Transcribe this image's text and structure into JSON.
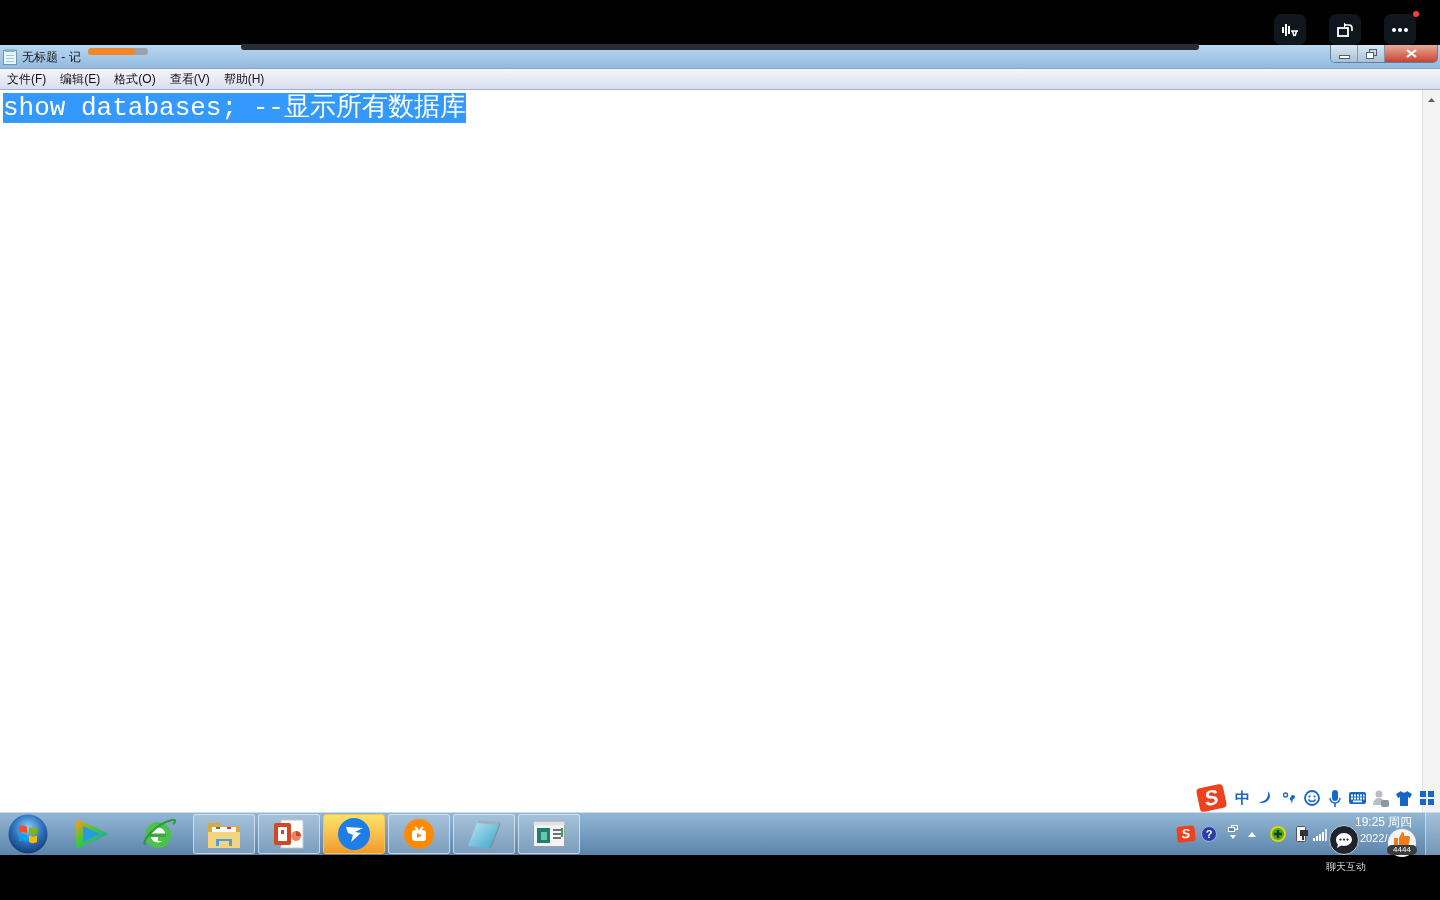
{
  "player_bar": {
    "buttons": [
      {
        "kind": "subtitle"
      },
      {
        "kind": "rotate"
      },
      {
        "kind": "more",
        "notification_dot": true
      }
    ]
  },
  "window": {
    "title": "无标题 - 记"
  },
  "loading_bar": {
    "level": 0.78
  },
  "menu": [
    "文件(F)",
    "编辑(E)",
    "格式(O)",
    "查看(V)",
    "帮助(H)"
  ],
  "editor": {
    "text": "show databases; --显示所有数据库",
    "selected": true
  },
  "ime_toolbar": {
    "logo": "S",
    "mode": "中"
  },
  "taskbar": {
    "pinned": [
      {
        "kind": "start"
      },
      {
        "kind": "player"
      },
      {
        "kind": "browser"
      }
    ],
    "windows": [
      {
        "kind": "folder",
        "selected": false
      },
      {
        "kind": "presentation",
        "selected": false
      },
      {
        "kind": "messenger",
        "selected": true
      },
      {
        "kind": "video",
        "selected": false
      },
      {
        "kind": "notepad",
        "selected": false
      },
      {
        "kind": "window",
        "selected": false
      }
    ]
  },
  "tray": {
    "ime_logo": "S",
    "help": "?",
    "time": "19:25",
    "weekday": "周四",
    "date": "2022/"
  },
  "player_overlay": {
    "likes": "4444",
    "chat_label": "聊天互动"
  }
}
